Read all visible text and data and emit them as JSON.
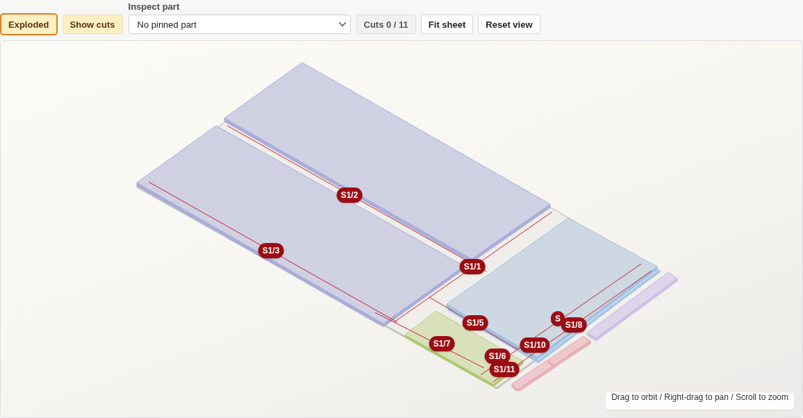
{
  "toolbar": {
    "toggles": [
      {
        "label": "Exploded",
        "on": true,
        "focused": true
      },
      {
        "label": "Show cuts",
        "on": true,
        "focused": false
      }
    ],
    "inspect_part": {
      "label": "Inspect part",
      "value": "No pinned part"
    },
    "buttons": [
      {
        "label": "Cuts 0 / 11",
        "disabled": true
      },
      {
        "label": "Fit sheet",
        "disabled": false
      },
      {
        "label": "Reset view",
        "disabled": false
      }
    ]
  },
  "viewport": {
    "cut_labels": [
      "S1/2",
      "S1/3",
      "S1/1",
      "S",
      "S1/5",
      "S1/8",
      "S1/7",
      "S1/10",
      "S1/6",
      "S1/11"
    ],
    "hint": "Drag to orbit / Right-drag to pan / Scroll to zoom"
  }
}
